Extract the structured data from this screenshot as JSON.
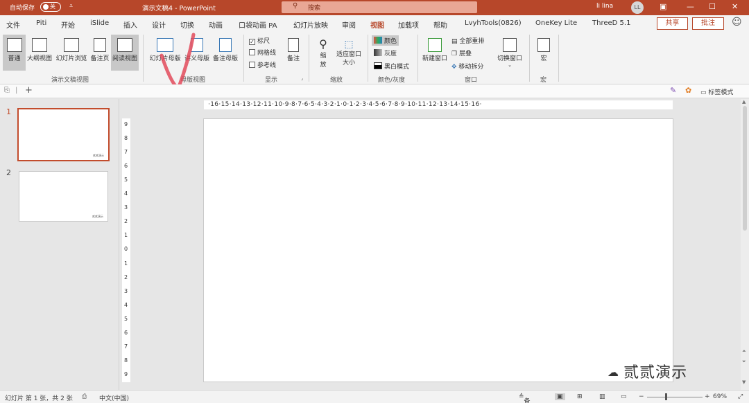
{
  "titlebar": {
    "autosave_label": "自动保存",
    "autosave_state": "关",
    "qat_icon": "qat-dropdown-icon",
    "doc_title": "演示文稿4  -  PowerPoint",
    "search_placeholder": "搜索",
    "user_name": "li lina",
    "user_initials": "LL",
    "accent_color": "#b7472a"
  },
  "tabs": [
    "文件",
    "Piti",
    "开始",
    "iSlide",
    "插入",
    "设计",
    "切换",
    "动画",
    "口袋动画 PA",
    "幻灯片放映",
    "审阅",
    "视图",
    "加载项",
    "帮助",
    "LvyhTools(0826)",
    "OneKey Lite",
    "ThreeD 5.1"
  ],
  "active_tab": "视图",
  "share_label": "共享",
  "comment_label": "批注",
  "ribbon": {
    "presentation_views": {
      "group_label": "演示文稿视图",
      "buttons": [
        "普通",
        "大纲视图",
        "幻灯片浏览",
        "备注页",
        "阅读视图"
      ]
    },
    "master_views": {
      "group_label": "母版视图",
      "buttons": [
        "幻灯片母版",
        "讲义母版",
        "备注母版"
      ]
    },
    "show": {
      "group_label": "显示",
      "checkboxes": [
        {
          "label": "标尺",
          "checked": true
        },
        {
          "label": "网格线",
          "checked": false
        },
        {
          "label": "参考线",
          "checked": false
        }
      ],
      "notes_label": "备注"
    },
    "zoom": {
      "group_label": "缩放",
      "zoom_label": "缩放",
      "fit_label": "适应窗口大小"
    },
    "color": {
      "group_label": "颜色/灰度",
      "options": [
        "颜色",
        "灰度",
        "黑白模式"
      ]
    },
    "window": {
      "group_label": "窗口",
      "new_window": "新建窗口",
      "arrange_all": "全部重排",
      "cascade": "层叠",
      "move_split": "移动拆分",
      "switch_window": "切换窗口"
    },
    "macros": {
      "group_label": "宏",
      "macro_label": "宏"
    }
  },
  "subbar": {
    "tag_mode_label": "标签模式"
  },
  "ruler": {
    "horizontal": "·16·15·14·13·12·11·10·9·8·7·6·5·4·3·2·1·0·1·2·3·4·5·6·7·8·9·10·11·12·13·14·15·16·",
    "vertical": [
      "9",
      "8",
      "7",
      "6",
      "5",
      "4",
      "3",
      "2",
      "1",
      "0",
      "1",
      "2",
      "3",
      "4",
      "5",
      "6",
      "7",
      "8",
      "9"
    ]
  },
  "slides": [
    {
      "number": "1",
      "caption": "贰贰演示"
    },
    {
      "number": "2",
      "caption": "贰贰演示"
    }
  ],
  "watermark": "贰贰演示",
  "statusbar": {
    "slide_info": "幻灯片 第 1 张，共 2 张",
    "language": "中文(中国)",
    "notes_label": "备注",
    "zoom_level": "69%"
  }
}
